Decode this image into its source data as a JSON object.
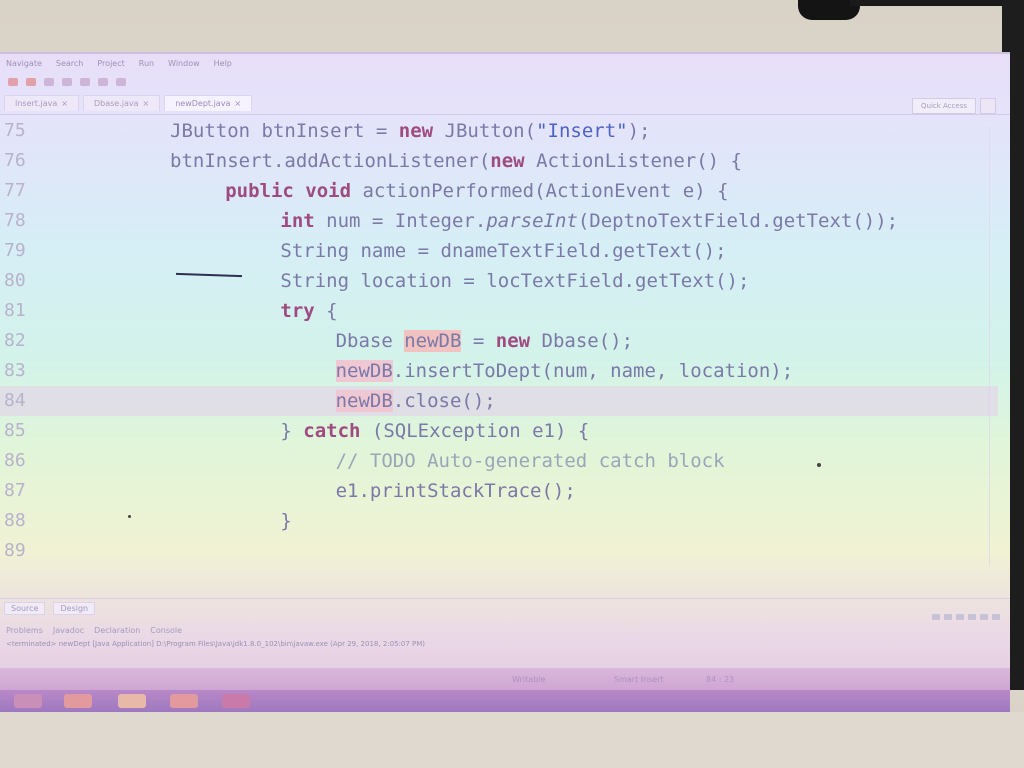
{
  "menubar": [
    "Navigate",
    "Search",
    "Project",
    "Run",
    "Window",
    "Help"
  ],
  "editor_tabs": [
    {
      "label": "Insert.java",
      "active": false
    },
    {
      "label": "Dbase.java",
      "active": false
    },
    {
      "label": "newDept.java",
      "active": true
    }
  ],
  "quick_access": "Quick Access",
  "code_lines": [
    {
      "n": "75",
      "indent": 6,
      "tokens": [
        {
          "t": "JButton btnInsert = ",
          "c": ""
        },
        {
          "t": "new",
          "c": "kw"
        },
        {
          "t": " JButton(",
          "c": ""
        },
        {
          "t": "\"Insert\"",
          "c": "str"
        },
        {
          "t": ");",
          "c": ""
        }
      ]
    },
    {
      "n": "76",
      "indent": 6,
      "tokens": [
        {
          "t": "btnInsert.addActionListener(",
          "c": ""
        },
        {
          "t": "new",
          "c": "kw"
        },
        {
          "t": " ActionListener() {",
          "c": ""
        }
      ]
    },
    {
      "n": "77",
      "indent": 8,
      "tokens": [
        {
          "t": "public",
          "c": "kw"
        },
        {
          "t": " ",
          "c": ""
        },
        {
          "t": "void",
          "c": "kw"
        },
        {
          "t": " actionPerformed(ActionEvent e) {",
          "c": ""
        }
      ]
    },
    {
      "n": "78",
      "indent": 10,
      "tokens": [
        {
          "t": "int",
          "c": "kw"
        },
        {
          "t": " num = Integer.",
          "c": ""
        },
        {
          "t": "parseInt",
          "c": "it"
        },
        {
          "t": "(DeptnoTextField.getText());",
          "c": ""
        }
      ]
    },
    {
      "n": "79",
      "indent": 10,
      "tokens": [
        {
          "t": "String name = dnameTextField.getText();",
          "c": ""
        }
      ]
    },
    {
      "n": "80",
      "indent": 10,
      "tokens": [
        {
          "t": "String location = locTextField.getText();",
          "c": ""
        }
      ]
    },
    {
      "n": "81",
      "indent": 10,
      "tokens": [
        {
          "t": "try",
          "c": "kw"
        },
        {
          "t": " {",
          "c": ""
        }
      ]
    },
    {
      "n": "82",
      "indent": 12,
      "tokens": [
        {
          "t": "Dbase ",
          "c": ""
        },
        {
          "t": "newDB",
          "c": "occ"
        },
        {
          "t": " = ",
          "c": ""
        },
        {
          "t": "new",
          "c": "kw"
        },
        {
          "t": " Dbase();",
          "c": ""
        }
      ]
    },
    {
      "n": "83",
      "indent": 12,
      "tokens": [
        {
          "t": "newDB",
          "c": "occ2"
        },
        {
          "t": ".insertToDept(num, name, location);",
          "c": ""
        }
      ]
    },
    {
      "n": "84",
      "indent": 12,
      "current": true,
      "tokens": [
        {
          "t": "newDB",
          "c": "occ2"
        },
        {
          "t": ".close();",
          "c": ""
        }
      ]
    },
    {
      "n": "85",
      "indent": 10,
      "tokens": [
        {
          "t": "} ",
          "c": ""
        },
        {
          "t": "catch",
          "c": "kw"
        },
        {
          "t": " (SQLException e1) {",
          "c": ""
        }
      ]
    },
    {
      "n": "86",
      "indent": 12,
      "tokens": [
        {
          "t": "// TODO Auto-generated catch block",
          "c": "cmt"
        }
      ]
    },
    {
      "n": "87",
      "indent": 12,
      "tokens": [
        {
          "t": "e1.printStackTrace();",
          "c": ""
        }
      ]
    },
    {
      "n": "88",
      "indent": 10,
      "tokens": [
        {
          "t": "}",
          "c": ""
        }
      ]
    },
    {
      "n": "89",
      "indent": 0,
      "tokens": []
    }
  ],
  "bottom_tabs": [
    "Source",
    "Design"
  ],
  "views_tabs": [
    "Problems",
    "Javadoc",
    "Declaration",
    "Console"
  ],
  "console_title": "<terminated> newDept [Java Application] D:\\Program Files\\Java\\jdk1.8.0_102\\bin\\javaw.exe (Apr 29, 2018, 2:05:07 PM)",
  "status": {
    "writable": "Writable",
    "insert_mode": "Smart Insert",
    "position": "84 : 23"
  }
}
